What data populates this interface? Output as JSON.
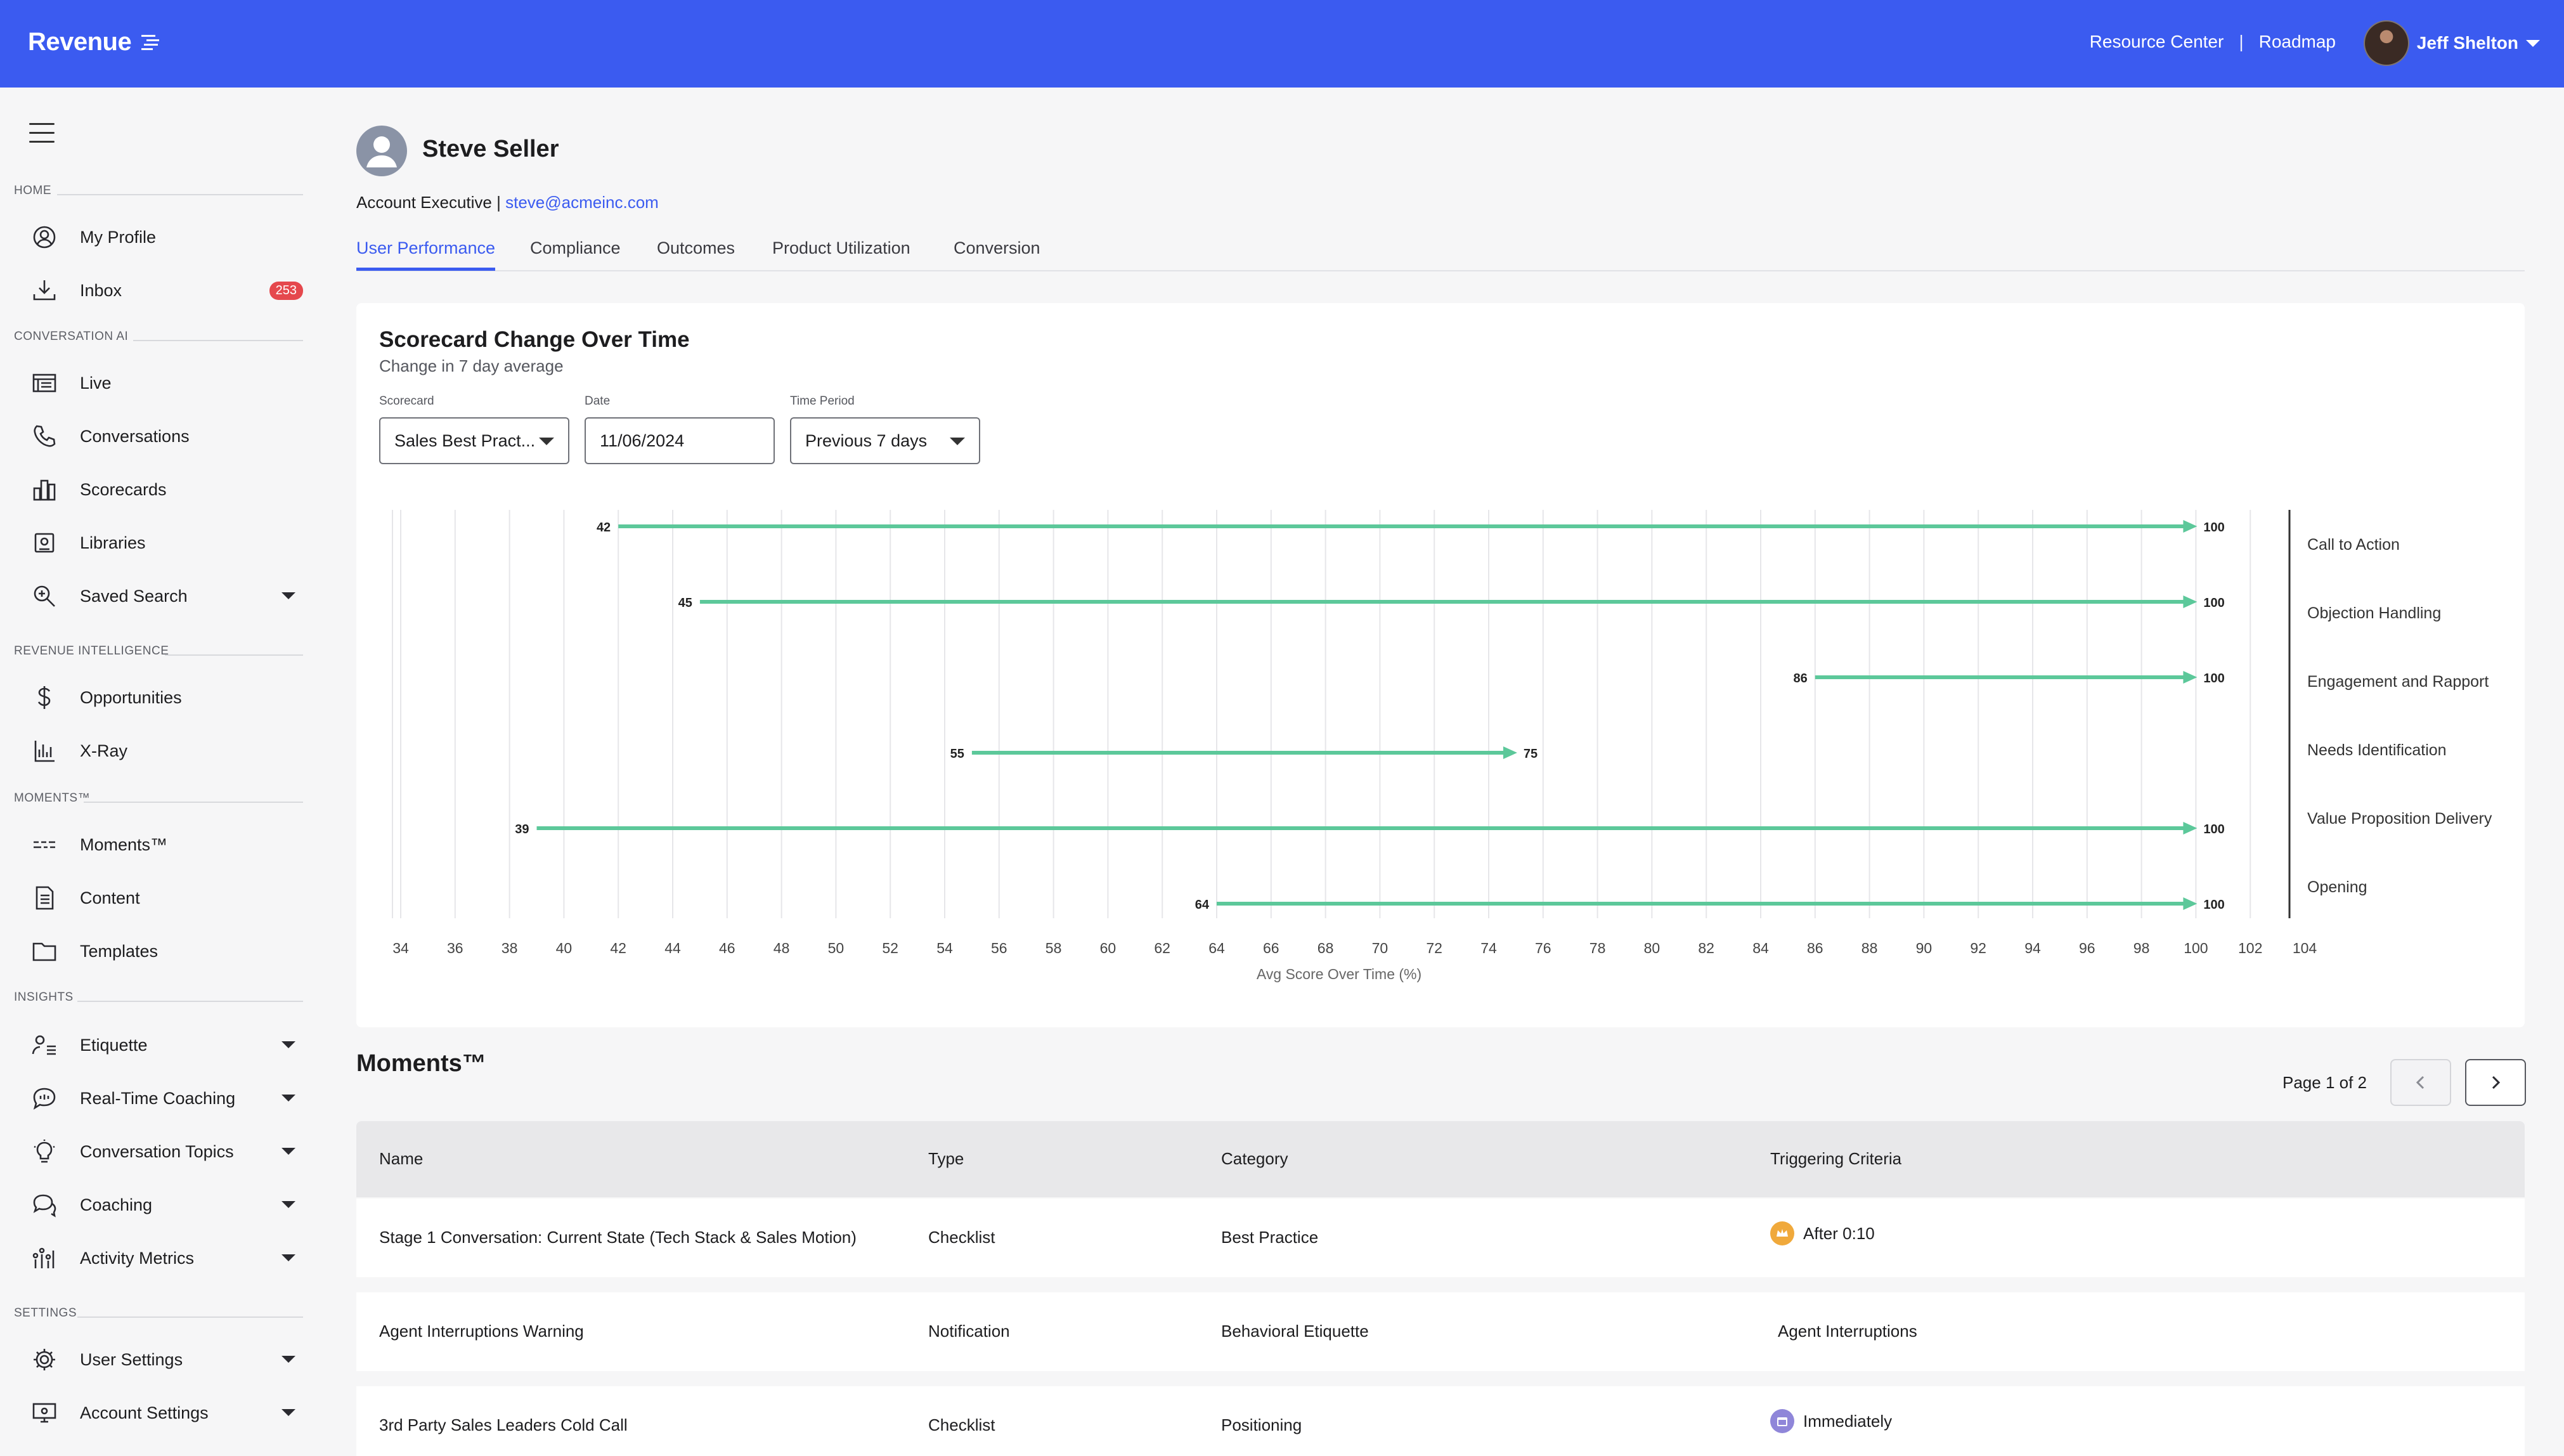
{
  "header": {
    "logo": "Revenue",
    "links": [
      "Resource Center",
      "Roadmap"
    ],
    "separator": "|",
    "user_name": "Jeff Shelton"
  },
  "sidebar": {
    "sections": [
      {
        "label": "HOME",
        "items": [
          {
            "label": "My Profile",
            "icon": "user-circle-icon"
          },
          {
            "label": "Inbox",
            "icon": "inbox-download-icon",
            "badge": "253"
          }
        ]
      },
      {
        "label": "CONVERSATION AI",
        "items": [
          {
            "label": "Live",
            "icon": "live-list-icon"
          },
          {
            "label": "Conversations",
            "icon": "phone-icon"
          },
          {
            "label": "Scorecards",
            "icon": "scorecard-bars-icon"
          },
          {
            "label": "Libraries",
            "icon": "library-icon"
          },
          {
            "label": "Saved Search",
            "icon": "search-plus-icon",
            "caret": true
          }
        ]
      },
      {
        "label": "REVENUE INTELLIGENCE",
        "items": [
          {
            "label": "Opportunities",
            "icon": "dollar-icon"
          },
          {
            "label": "X-Ray",
            "icon": "bar-chart-icon"
          }
        ]
      },
      {
        "label": "MOMENTS™",
        "items": [
          {
            "label": "Moments™",
            "icon": "moments-lines-icon"
          },
          {
            "label": "Content",
            "icon": "document-icon"
          },
          {
            "label": "Templates",
            "icon": "folder-icon"
          }
        ]
      },
      {
        "label": "INSIGHTS",
        "items": [
          {
            "label": "Etiquette",
            "icon": "person-lines-icon",
            "caret": true
          },
          {
            "label": "Real-Time Coaching",
            "icon": "chat-bubble-icon",
            "caret": true
          },
          {
            "label": "Conversation Topics",
            "icon": "lightbulb-icon",
            "caret": true
          },
          {
            "label": "Coaching",
            "icon": "chat-bubbles-icon",
            "caret": true
          },
          {
            "label": "Activity Metrics",
            "icon": "activity-icon",
            "caret": true
          }
        ]
      },
      {
        "label": "SETTINGS",
        "items": [
          {
            "label": "User Settings",
            "icon": "gear-icon",
            "caret": true
          },
          {
            "label": "Account Settings",
            "icon": "monitor-gear-icon",
            "caret": true
          }
        ]
      }
    ]
  },
  "profile": {
    "name": "Steve Seller",
    "role": "Account Executive",
    "separator": "|",
    "email": "steve@acmeinc.com"
  },
  "tabs": [
    {
      "label": "User Performance",
      "active": true
    },
    {
      "label": "Compliance",
      "active": false
    },
    {
      "label": "Outcomes",
      "active": false
    },
    {
      "label": "Product Utilization",
      "active": false
    },
    {
      "label": "Conversion",
      "active": false
    }
  ],
  "scorecard_card": {
    "title": "Scorecard Change Over Time",
    "subtitle": "Change in 7 day average",
    "filters": {
      "scorecard": {
        "label": "Scorecard",
        "value": "Sales Best Pract..."
      },
      "date": {
        "label": "Date",
        "value": "11/06/2024"
      },
      "time_period": {
        "label": "Time Period",
        "value": "Previous 7 days"
      }
    }
  },
  "chart_data": {
    "type": "dumbbell",
    "xlabel": "Avg Score Over Time (%)",
    "xlim": [
      33,
      104
    ],
    "xticks": [
      34,
      36,
      38,
      40,
      42,
      44,
      46,
      48,
      50,
      52,
      54,
      56,
      58,
      60,
      62,
      64,
      66,
      68,
      70,
      72,
      74,
      76,
      78,
      80,
      82,
      84,
      86,
      88,
      90,
      92,
      94,
      96,
      98,
      100,
      102,
      104
    ],
    "series_color": "#5cc89a",
    "categories": [
      "Call to Action",
      "Objection Handling",
      "Engagement and Rapport",
      "Needs Identification",
      "Value Proposition Delivery",
      "Opening"
    ],
    "start": [
      42,
      45,
      86,
      55,
      39,
      64
    ],
    "end": [
      100,
      100,
      100,
      75,
      100,
      100
    ]
  },
  "moments": {
    "title": "Moments™",
    "pager": "Page 1 of 2",
    "columns": [
      "Name",
      "Type",
      "Category",
      "Triggering Criteria"
    ],
    "rows": [
      {
        "name": "Stage 1 Conversation: Current State (Tech Stack & Sales Motion)",
        "type": "Checklist",
        "category": "Best Practice",
        "trigger": "After 0:10",
        "trigger_icon": "crown-icon",
        "trigger_color": "#f0a93b"
      },
      {
        "name": "Agent Interruptions Warning",
        "type": "Notification",
        "category": "Behavioral Etiquette",
        "trigger": "Agent Interruptions",
        "trigger_icon": "",
        "trigger_color": ""
      },
      {
        "name": "3rd Party Sales Leaders Cold Call",
        "type": "Checklist",
        "category": "Positioning",
        "trigger": "Immediately",
        "trigger_icon": "calendar-icon",
        "trigger_color": "#8f86d9"
      }
    ]
  }
}
